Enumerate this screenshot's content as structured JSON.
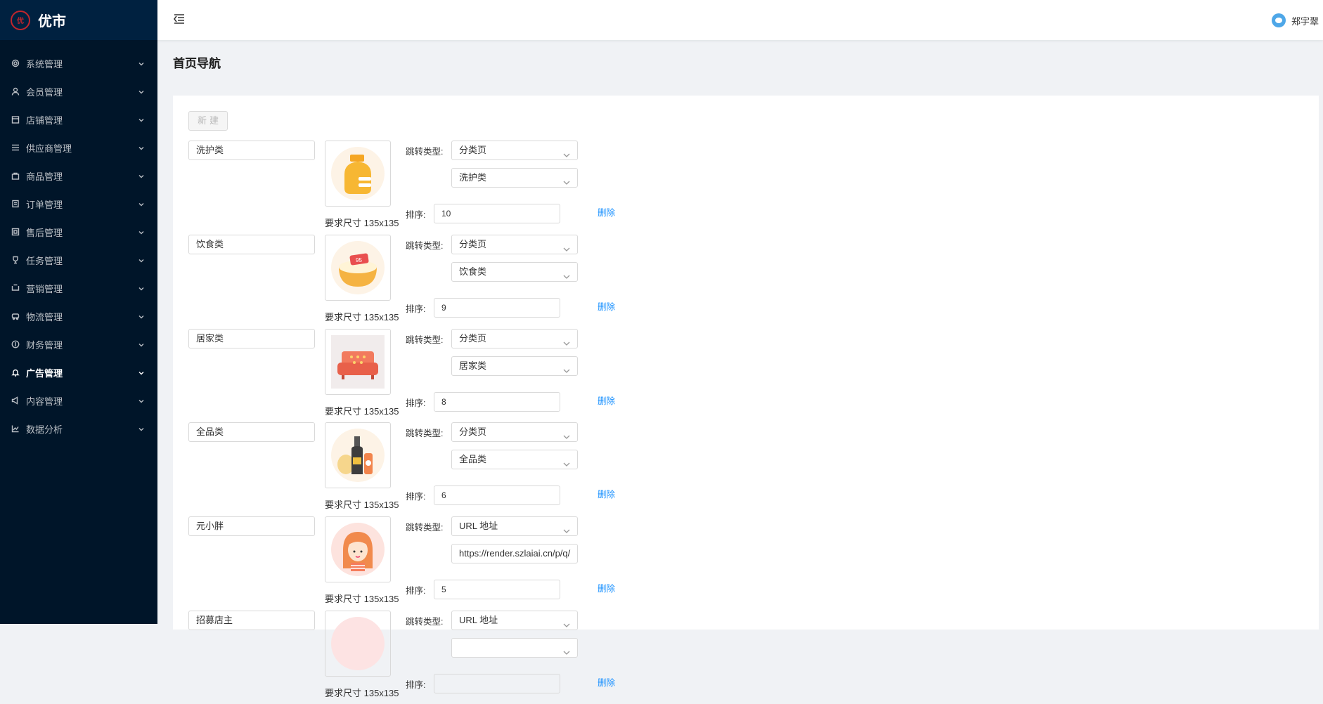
{
  "app": {
    "name": "优市",
    "logo_text": "优市"
  },
  "colors": {
    "sidebar_bg": "#001529",
    "logo_bg": "#002140",
    "link": "#1890ff",
    "brand": "#c0262d"
  },
  "sidebar": {
    "items": [
      {
        "label": "系统管理",
        "icon": "gear-icon"
      },
      {
        "label": "会员管理",
        "icon": "user-icon"
      },
      {
        "label": "店铺管理",
        "icon": "store-icon"
      },
      {
        "label": "供应商管理",
        "icon": "list-icon"
      },
      {
        "label": "商品管理",
        "icon": "bag-icon"
      },
      {
        "label": "订单管理",
        "icon": "order-icon"
      },
      {
        "label": "售后管理",
        "icon": "service-icon"
      },
      {
        "label": "任务管理",
        "icon": "trophy-icon"
      },
      {
        "label": "营销管理",
        "icon": "marketing-icon"
      },
      {
        "label": "物流管理",
        "icon": "truck-icon"
      },
      {
        "label": "财务管理",
        "icon": "money-icon"
      },
      {
        "label": "广告管理",
        "icon": "bell-icon",
        "active": true
      },
      {
        "label": "内容管理",
        "icon": "megaphone-icon"
      },
      {
        "label": "数据分析",
        "icon": "chart-icon"
      }
    ]
  },
  "header": {
    "user_name": "郑宇翠"
  },
  "page": {
    "title": "首页导航",
    "new_button": "新建"
  },
  "labels": {
    "jump_type": "跳转类型:",
    "sort": "排序:",
    "size_hint": "要求尺寸 135x135",
    "delete": "删除"
  },
  "entries": [
    {
      "name": "洗护类",
      "jump_type": "分类页",
      "target": "洗护类",
      "sort": "10",
      "image": "detergent-bottle"
    },
    {
      "name": "饮食类",
      "jump_type": "分类页",
      "target": "饮食类",
      "sort": "9",
      "image": "food-bowl"
    },
    {
      "name": "居家类",
      "jump_type": "分类页",
      "target": "居家类",
      "sort": "8",
      "image": "sofa"
    },
    {
      "name": "全品类",
      "jump_type": "分类页",
      "target": "全品类",
      "sort": "6",
      "image": "wine-bottles"
    },
    {
      "name": "元小胖",
      "jump_type": "URL 地址",
      "target": "https://render.szlaiai.cn/p/q/",
      "sort": "5",
      "image": "girl-avatar",
      "is_url": true
    },
    {
      "name": "招募店主",
      "jump_type": "URL 地址",
      "target": "",
      "sort": "",
      "image": "pink"
    }
  ]
}
